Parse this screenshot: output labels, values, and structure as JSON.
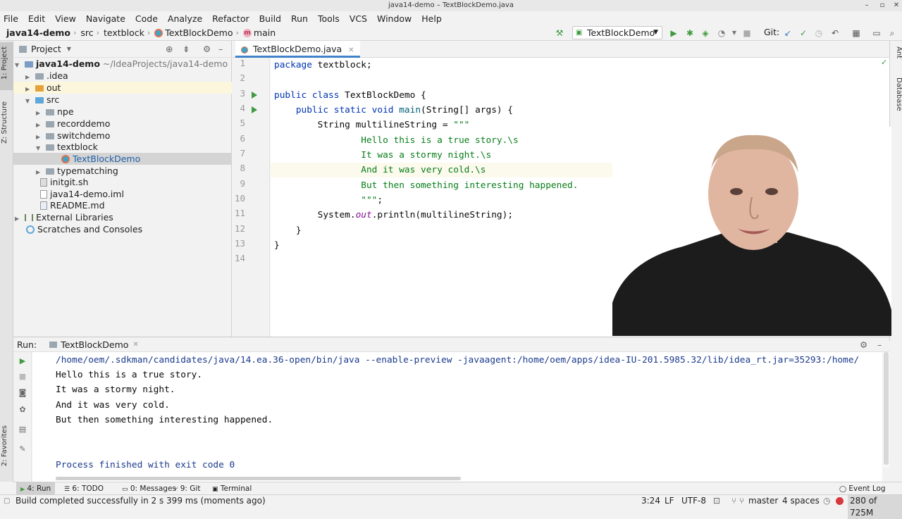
{
  "window": {
    "title": "java14-demo – TextBlockDemo.java"
  },
  "menu": [
    "File",
    "Edit",
    "View",
    "Navigate",
    "Code",
    "Analyze",
    "Refactor",
    "Build",
    "Run",
    "Tools",
    "VCS",
    "Window",
    "Help"
  ],
  "breadcrumb": {
    "project": "java14-demo",
    "src": "src",
    "pkg": "textblock",
    "cls": "TextBlockDemo",
    "method": "main"
  },
  "toolbar": {
    "run_config": "TextBlockDemo",
    "git_label": "Git:"
  },
  "project_panel": {
    "title": "Project",
    "tree": [
      {
        "label": "java14-demo",
        "path": "~/IdeaProjects/java14-demo",
        "level": 0,
        "type": "module"
      },
      {
        "label": ".idea",
        "level": 1,
        "type": "folder"
      },
      {
        "label": "out",
        "level": 1,
        "type": "folder-orange"
      },
      {
        "label": "src",
        "level": 1,
        "type": "folder-blue"
      },
      {
        "label": "npe",
        "level": 2,
        "type": "folder"
      },
      {
        "label": "recorddemo",
        "level": 2,
        "type": "folder"
      },
      {
        "label": "switchdemo",
        "level": 2,
        "type": "folder"
      },
      {
        "label": "textblock",
        "level": 2,
        "type": "folder"
      },
      {
        "label": "TextBlockDemo",
        "level": 3,
        "type": "class"
      },
      {
        "label": "typematching",
        "level": 2,
        "type": "folder"
      },
      {
        "label": "initgit.sh",
        "level": 1,
        "type": "file"
      },
      {
        "label": "java14-demo.iml",
        "level": 1,
        "type": "file"
      },
      {
        "label": "README.md",
        "level": 1,
        "type": "file"
      },
      {
        "label": "External Libraries",
        "level": 0,
        "type": "lib"
      },
      {
        "label": "Scratches and Consoles",
        "level": 0,
        "type": "scratch"
      }
    ]
  },
  "editor": {
    "tab": "TextBlockDemo.java",
    "line_numbers": [
      "1",
      "2",
      "3",
      "4",
      "5",
      "6",
      "7",
      "8",
      "9",
      "10",
      "11",
      "12",
      "13",
      "14"
    ],
    "lines": {
      "l1a": "package",
      "l1b": " textblock;",
      "l3a": "public class",
      "l3b": " TextBlockDemo {",
      "l4a": "    public static void",
      "l4b": " main",
      "l4c": "(String[] args) {",
      "l5a": "        String multilineString = ",
      "l5b": "\"\"\"",
      "l6": "                Hello this is a true story.\\s",
      "l7": "                It was a stormy night.\\s",
      "l8": "                And it was very cold.\\s",
      "l9": "                But then something interesting happened.",
      "l10a": "                \"\"\"",
      "l10b": ";",
      "l11a": "        System.",
      "l11b": "out",
      "l11c": ".println(multilineString);",
      "l12": "    }",
      "l13": "}"
    }
  },
  "run_panel": {
    "label": "Run:",
    "tab": "TextBlockDemo",
    "console": [
      "/home/oem/.sdkman/candidates/java/14.ea.36-open/bin/java --enable-preview -javaagent:/home/oem/apps/idea-IU-201.5985.32/lib/idea_rt.jar=35293:/home/",
      "Hello this is a true story.",
      "It was a stormy night.",
      "And it was very cold.",
      "But then something interesting happened.",
      "",
      "",
      "Process finished with exit code 0"
    ]
  },
  "side_tabs": {
    "project": "1: Project",
    "structure": "Z: Structure",
    "favorites": "2: Favorites",
    "ant": "Ant",
    "database": "Database"
  },
  "tool_tabs": [
    "4: Run",
    "6: TODO",
    "0: Messages",
    "9: Git",
    "Terminal"
  ],
  "event_log": "Event Log",
  "status": {
    "message": "Build completed successfully in 2 s 399 ms (moments ago)",
    "position": "3:24",
    "line_sep": "LF",
    "encoding": "UTF-8",
    "branch": "master",
    "indent": "4 spaces",
    "memory": "280 of 725M"
  }
}
